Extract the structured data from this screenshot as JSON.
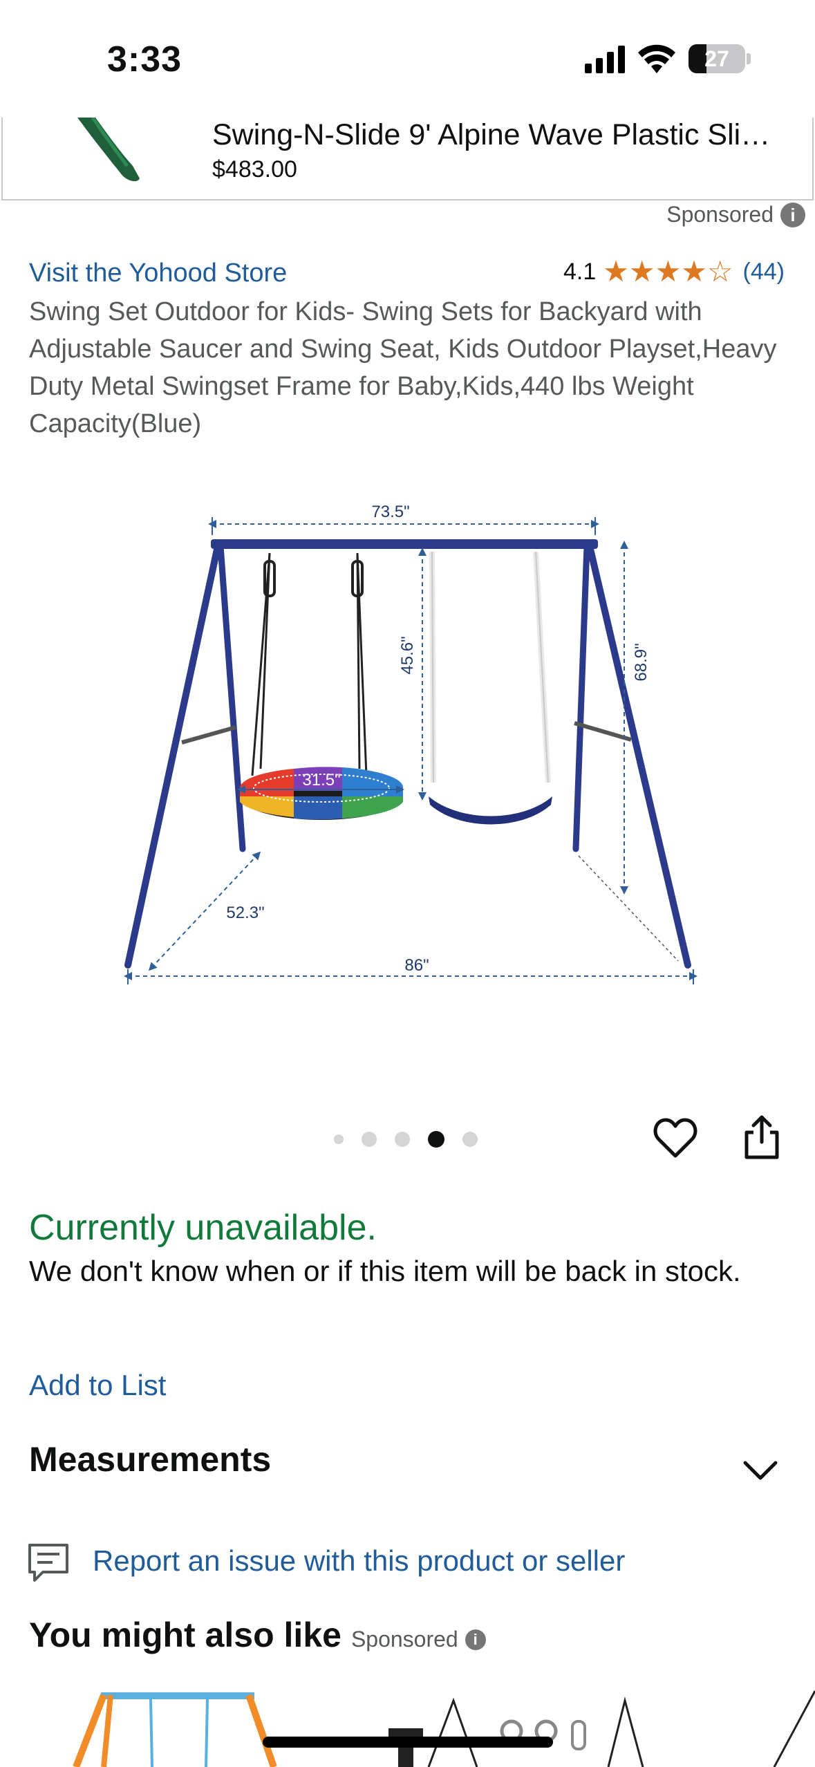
{
  "status_bar": {
    "time": "3:33",
    "battery": "27"
  },
  "banner": {
    "title": "Swing-N-Slide 9' Alpine Wave Plastic Sli…",
    "price": "$483.00"
  },
  "sponsored_label": "Sponsored",
  "store": {
    "link_text": "Visit the Yohood Store",
    "rating_value": "4.1",
    "rating_stars": 4,
    "rating_max": 5,
    "rating_count": "(44)"
  },
  "product": {
    "title": "Swing Set Outdoor for Kids- Swing Sets for Backyard with Adjustable Saucer and Swing Seat, Kids Outdoor Playset,Heavy Duty Metal Swingset Frame for Baby,Kids,440 lbs Weight Capacity(Blue)",
    "image_labels": {
      "top_width": "73.5\"",
      "chain_height": "45.6\"",
      "frame_height": "68.9\"",
      "saucer": "31.5\"",
      "depth": "52.3\"",
      "base_width": "86\""
    }
  },
  "carousel": {
    "count": 5,
    "active_index": 3
  },
  "availability": {
    "status": "Currently unavailable.",
    "message": "We don't know when or if this item will be back in stock."
  },
  "add_to_list": "Add to List",
  "measurements_title": "Measurements",
  "report_link": "Report an issue with this product or seller",
  "also_like": {
    "title": "You might also like",
    "sponsored": "Sponsored"
  },
  "colors": {
    "link": "#1f5c99",
    "available_green": "#117a3a",
    "star": "#de7921",
    "frame_navy": "#2b3a8a"
  }
}
